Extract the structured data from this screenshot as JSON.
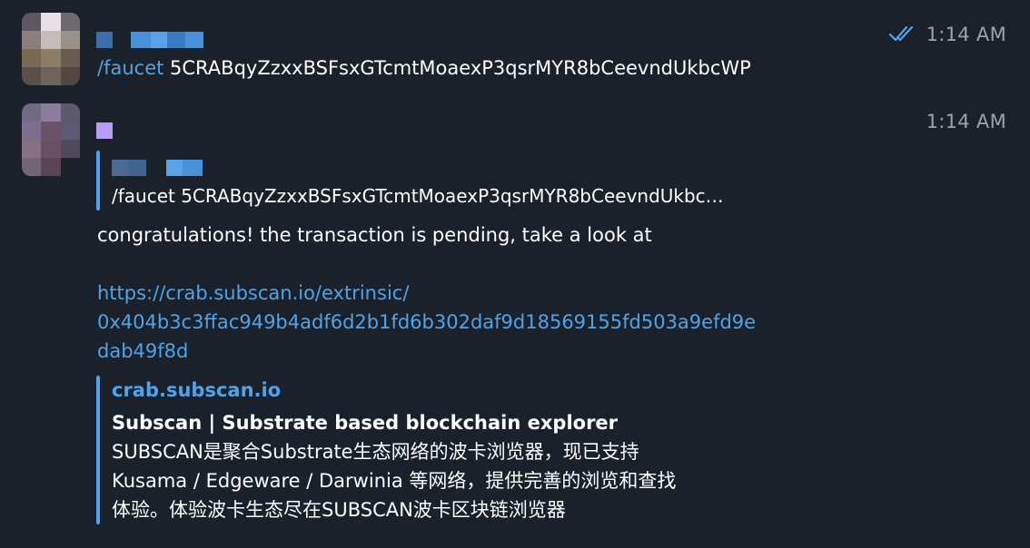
{
  "colors": {
    "background": "#1b212b",
    "accent": "#4fa3ea",
    "timestamp": "#9aa3ad",
    "text": "#ffffff"
  },
  "messages": [
    {
      "time": "1:14 AM",
      "status_icon": "double-check-icon",
      "command": "/faucet",
      "address": " 5CRABqyZzxxBSFsxGTcmtMoaexP3qsrMYR8bCeevndUkbcWP"
    },
    {
      "time": "1:14 AM",
      "reply": {
        "text": "/faucet 5CRABqyZzxxBSFsxGTcmtMoaexP3qsrMYR8bCeevndUkbc…"
      },
      "body": "congratulations! the transaction is pending, take a look at",
      "link_lines": [
        "https://crab.subscan.io/extrinsic/",
        "0x404b3c3ffac949b4adf6d2b1fd6b302daf9d18569155fd503a9efd9e",
        "dab49f8d"
      ],
      "preview": {
        "site": "crab.subscan.io",
        "title": "Subscan | Substrate based blockchain explorer",
        "description_lines": [
          "SUBSCAN是聚合Substrate生态网络的波卡浏览器，现已支持",
          "Kusama / Edgeware / Darwinia 等网络，提供完善的浏览和查找",
          "体验。体验波卡生态尽在SUBSCAN波卡区块链浏览器"
        ]
      }
    }
  ]
}
